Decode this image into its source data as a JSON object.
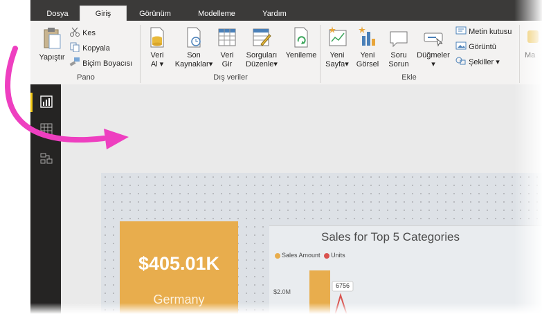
{
  "tabs": [
    "Dosya",
    "Giriş",
    "Görünüm",
    "Modelleme",
    "Yardım"
  ],
  "clipboard": {
    "paste": "Yapıştır",
    "cut": "Kes",
    "copy": "Kopyala",
    "format_painter": "Biçim Boyacısı",
    "group": "Pano"
  },
  "external_data": {
    "get_data": [
      "Veri",
      "Al"
    ],
    "recent_sources": [
      "Son",
      "Kaynaklar"
    ],
    "enter_data": [
      "Veri",
      "Gir"
    ],
    "edit_queries": [
      "Sorguları",
      "Düzenle"
    ],
    "refresh": "Yenileme",
    "group": "Dış veriler"
  },
  "insert": {
    "new_page": [
      "Yeni",
      "Sayfa"
    ],
    "new_visual": [
      "Yeni",
      "Görsel"
    ],
    "ask_question": [
      "Soru",
      "Sorun"
    ],
    "buttons": "Düğmeler",
    "text_box": "Metin kutusu",
    "image": "Görüntü",
    "shapes": "Şekiller",
    "group": "Ekle"
  },
  "partial_button": "Ma",
  "card": {
    "value": "$405.01K",
    "label": "Germany"
  },
  "chart_data": {
    "type": "bar",
    "title": "Sales for Top 5 Categories",
    "series": [
      {
        "name": "Sales Amount",
        "color": "#e8ad4d"
      },
      {
        "name": "Units",
        "color": "#d9534f"
      }
    ],
    "y_tick": "$2.0M",
    "data_label": "6756"
  },
  "colors": {
    "accent": "#f2c811",
    "arrow": "#ee3fc0",
    "nav": "#252423"
  }
}
